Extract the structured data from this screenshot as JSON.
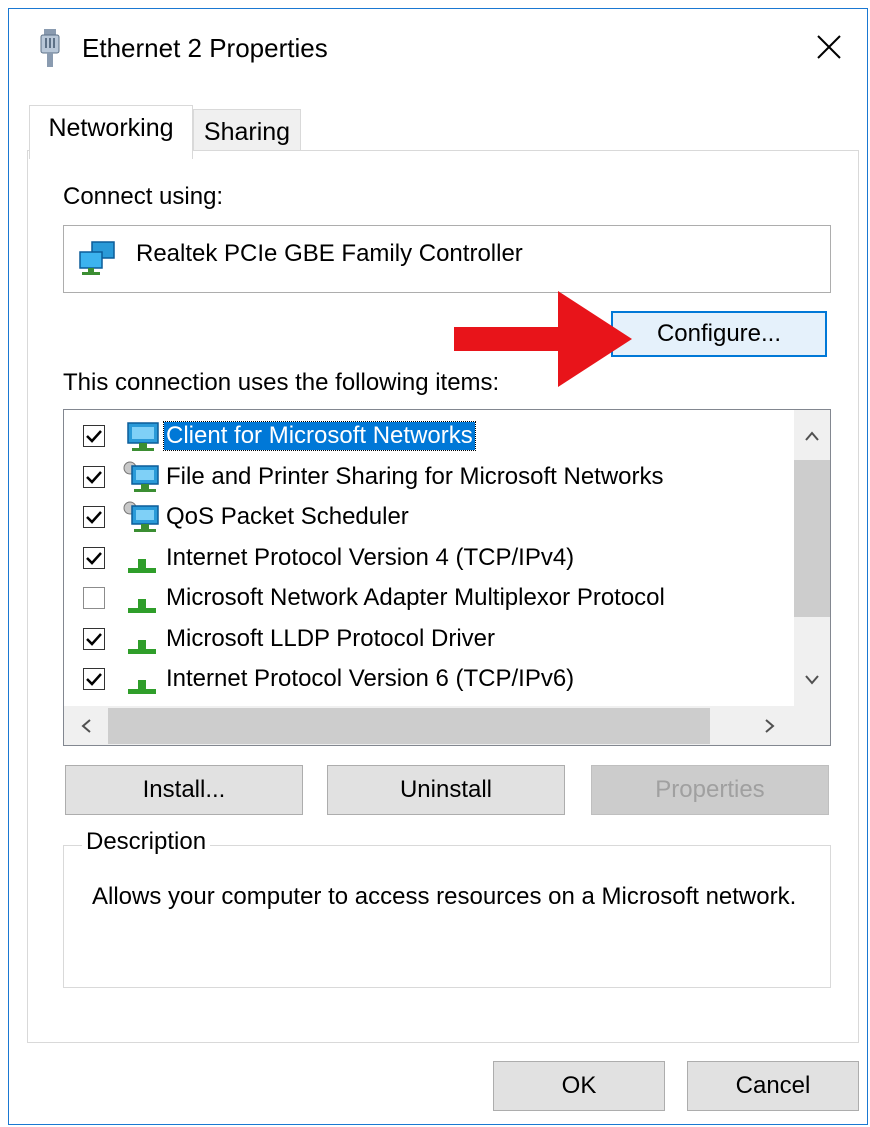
{
  "window": {
    "title": "Ethernet 2 Properties",
    "icon": "network-adapter-icon",
    "close_glyph": "✕"
  },
  "tabs": [
    {
      "label": "Networking",
      "selected": true
    },
    {
      "label": "Sharing",
      "selected": false
    }
  ],
  "networking": {
    "connect_using_label": "Connect using:",
    "device_icon": "network-adapter-icon",
    "device_name": "Realtek PCIe GBE Family Controller",
    "configure_label": "Configure...",
    "items_label": "This connection uses the following items:",
    "items": [
      {
        "label": "Client for Microsoft Networks",
        "checked": true,
        "icon": "client-network-icon",
        "selected": true
      },
      {
        "label": "File and Printer Sharing for Microsoft Networks",
        "checked": true,
        "icon": "service-network-icon",
        "selected": false
      },
      {
        "label": "QoS Packet Scheduler",
        "checked": true,
        "icon": "service-network-icon",
        "selected": false
      },
      {
        "label": "Internet Protocol Version 4 (TCP/IPv4)",
        "checked": true,
        "icon": "protocol-icon",
        "selected": false
      },
      {
        "label": "Microsoft Network Adapter Multiplexor Protocol",
        "checked": false,
        "icon": "protocol-icon",
        "selected": false
      },
      {
        "label": "Microsoft LLDP Protocol Driver",
        "checked": true,
        "icon": "protocol-icon",
        "selected": false
      },
      {
        "label": "Internet Protocol Version 6 (TCP/IPv6)",
        "checked": true,
        "icon": "protocol-icon",
        "selected": false
      }
    ],
    "buttons": {
      "install": "Install...",
      "uninstall": "Uninstall",
      "properties": "Properties"
    },
    "description_title": "Description",
    "description_text": "Allows your computer to access resources on a Microsoft network."
  },
  "footer": {
    "ok": "OK",
    "cancel": "Cancel"
  },
  "colors": {
    "accent": "#0078d7",
    "window_border": "#1a78d2",
    "annotation_arrow": "#e8141a"
  }
}
